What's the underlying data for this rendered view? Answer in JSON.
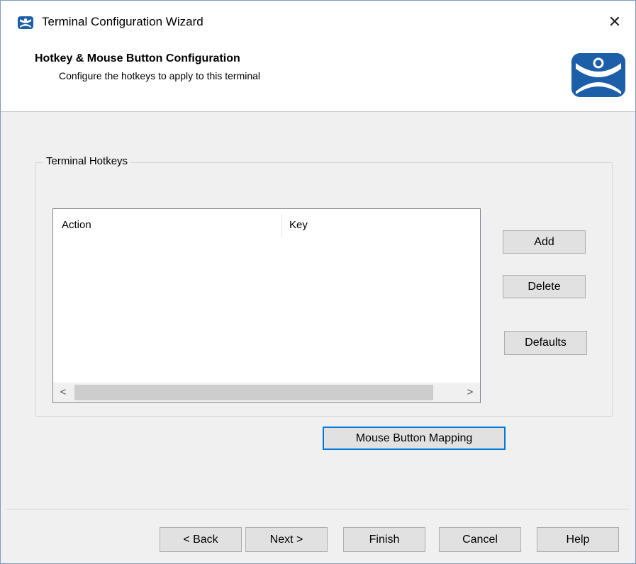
{
  "window": {
    "title": "Terminal Configuration Wizard",
    "close_glyph": "✕",
    "icon": "thinmanager-mask-icon"
  },
  "header": {
    "title": "Hotkey & Mouse Button Configuration",
    "subtitle": "Configure the hotkeys to apply to this terminal",
    "logo": "thinmanager-logo"
  },
  "group": {
    "label": "Terminal Hotkeys",
    "list": {
      "columns": [
        "Action",
        "Key"
      ],
      "rows": [],
      "scroll_left_glyph": "<",
      "scroll_right_glyph": ">"
    },
    "buttons": {
      "add": "Add",
      "delete": "Delete",
      "defaults": "Defaults"
    }
  },
  "mouse_button_mapping": "Mouse Button Mapping",
  "footer": {
    "back": "< Back",
    "next": "Next >",
    "finish": "Finish",
    "cancel": "Cancel",
    "help": "Help"
  },
  "colors": {
    "logo_blue": "#1c5ea8",
    "focus_border": "#0078d7"
  }
}
